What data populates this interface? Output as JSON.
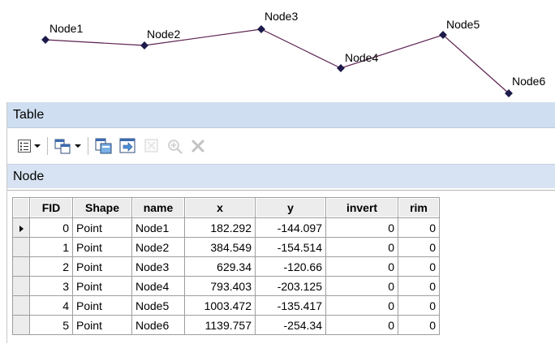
{
  "map": {
    "line_color": "#5b2050",
    "nodes": [
      {
        "label": "Node1"
      },
      {
        "label": "Node2"
      },
      {
        "label": "Node3"
      },
      {
        "label": "Node4"
      },
      {
        "label": "Node5"
      },
      {
        "label": "Node6"
      }
    ]
  },
  "window": {
    "title": "Table",
    "tab_label": "Node"
  },
  "toolbar": {
    "icons": [
      "table-options-icon",
      "related-tables-icon",
      "select-by-attributes-icon",
      "switch-selection-icon",
      "clear-selection-icon",
      "zoom-to-selected-icon",
      "delete-selected-icon"
    ]
  },
  "table": {
    "columns": [
      "FID",
      "Shape",
      "name",
      "x",
      "y",
      "invert",
      "rim"
    ],
    "rows": [
      {
        "FID": "0",
        "Shape": "Point",
        "name": "Node1",
        "x": "182.292",
        "y": "-144.097",
        "invert": "0",
        "rim": "0"
      },
      {
        "FID": "1",
        "Shape": "Point",
        "name": "Node2",
        "x": "384.549",
        "y": "-154.514",
        "invert": "0",
        "rim": "0"
      },
      {
        "FID": "2",
        "Shape": "Point",
        "name": "Node3",
        "x": "629.34",
        "y": "-120.66",
        "invert": "0",
        "rim": "0"
      },
      {
        "FID": "3",
        "Shape": "Point",
        "name": "Node4",
        "x": "793.403",
        "y": "-203.125",
        "invert": "0",
        "rim": "0"
      },
      {
        "FID": "4",
        "Shape": "Point",
        "name": "Node5",
        "x": "1003.472",
        "y": "-135.417",
        "invert": "0",
        "rim": "0"
      },
      {
        "FID": "5",
        "Shape": "Point",
        "name": "Node6",
        "x": "1139.757",
        "y": "-254.34",
        "invert": "0",
        "rim": "0"
      }
    ]
  }
}
